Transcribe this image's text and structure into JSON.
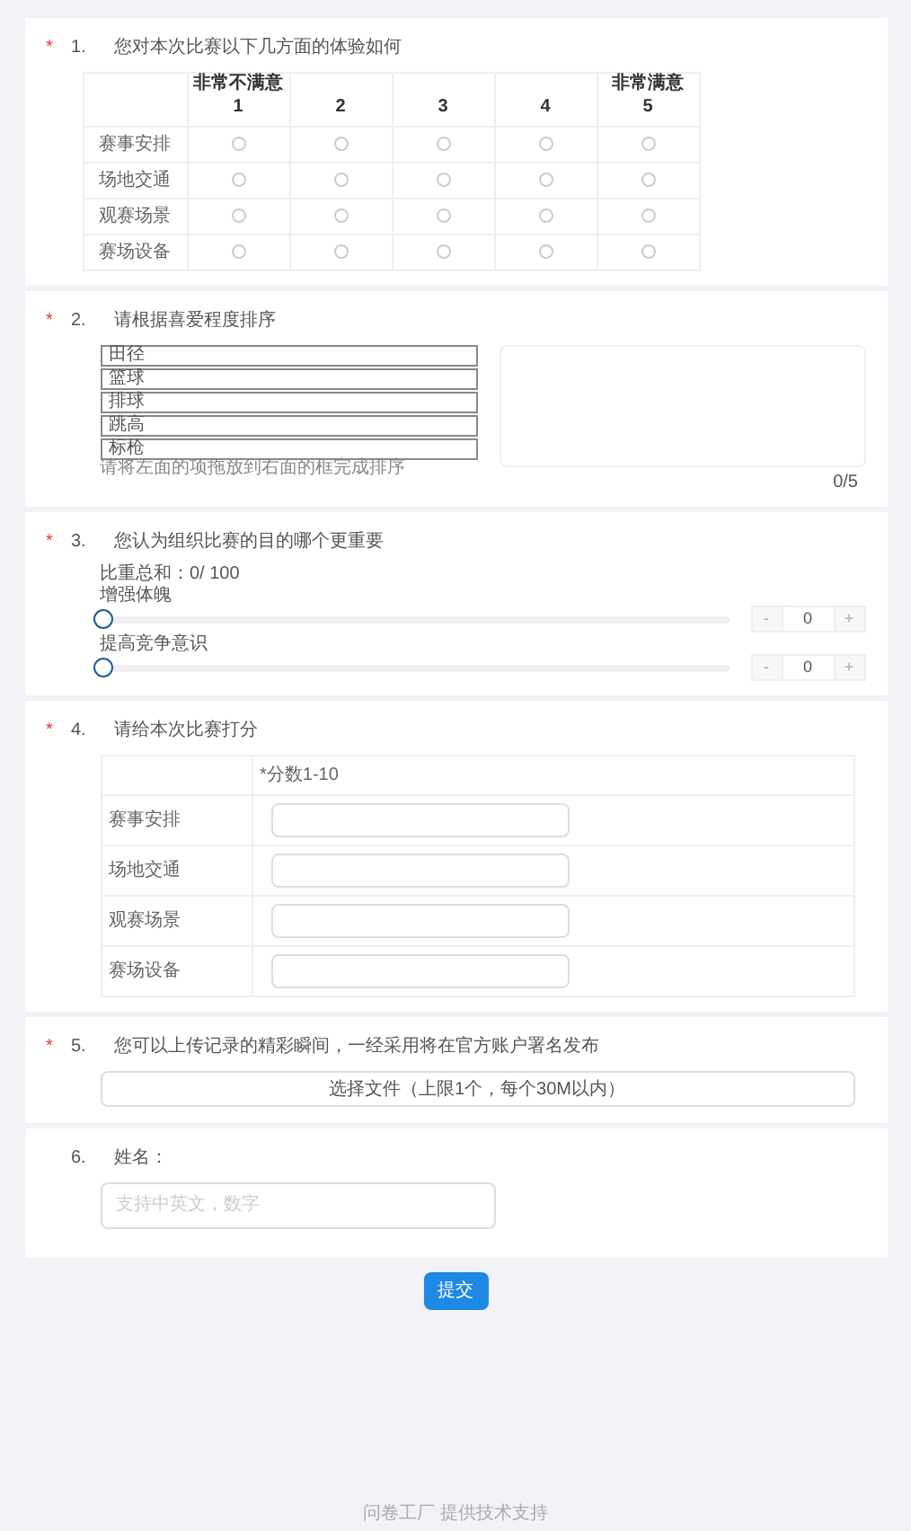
{
  "questions": [
    {
      "kind": "matrix",
      "mark": "*",
      "number": "1.",
      "title": "您对本次比赛以下几方面的体验如何",
      "columns": [
        {
          "label": "非常不满意",
          "value": "1"
        },
        {
          "value": "2"
        },
        {
          "value": "3"
        },
        {
          "value": "4"
        },
        {
          "label": "非常满意",
          "value": "5"
        }
      ],
      "rows": [
        {
          "label": "赛事安排",
          "choices": [
            {
              "selected": false
            },
            {
              "selected": false
            },
            {
              "selected": false
            },
            {
              "selected": false
            },
            {
              "selected": false
            }
          ]
        },
        {
          "label": "场地交通",
          "choices": [
            {
              "selected": false
            },
            {
              "selected": false
            },
            {
              "selected": false
            },
            {
              "selected": false
            },
            {
              "selected": false
            }
          ]
        },
        {
          "label": "观赛场景",
          "choices": [
            {
              "selected": false
            },
            {
              "selected": false
            },
            {
              "selected": false
            },
            {
              "selected": false
            },
            {
              "selected": false
            }
          ]
        },
        {
          "label": "赛场设备",
          "choices": [
            {
              "selected": false
            },
            {
              "selected": false
            },
            {
              "selected": false
            },
            {
              "selected": false
            },
            {
              "selected": false
            }
          ]
        }
      ]
    },
    {
      "kind": "sort",
      "mark": "*",
      "number": "2.",
      "title": "请根据喜爱程度排序",
      "items": [
        "田径",
        "篮球",
        "排球",
        "跳高",
        "标枪"
      ],
      "hint": "请将左面的项拖放到右面的框完成排序",
      "count": "0/5"
    },
    {
      "kind": "weights",
      "mark": "*",
      "number": "3.",
      "title": "您认为组织比赛的目的哪个更重要",
      "total": "比重总和：0/ 100",
      "options": [
        {
          "label": "增强体魄",
          "level": 0,
          "value": "0",
          "minus": "-",
          "plus": "+"
        },
        {
          "label": "提高竞争意识",
          "level": 0,
          "value": "0",
          "minus": "-",
          "plus": "+"
        }
      ]
    },
    {
      "kind": "scores",
      "mark": "*",
      "number": "4.",
      "title": "请给本次比赛打分",
      "header": "*分数1-10",
      "rows": [
        "赛事安排",
        "场地交通",
        "观赛场景",
        "赛场设备"
      ]
    },
    {
      "kind": "upload",
      "mark": "*",
      "number": "5.",
      "title": "您可以上传记录的精彩瞬间，一经采用将在官方账户署名发布",
      "button": "选择文件（上限1个，每个30M以内）"
    },
    {
      "kind": "text",
      "number": "6.",
      "title": "姓名：",
      "placeholder": "支持中英文，数字"
    }
  ],
  "submit": "提交",
  "footer": "问卷工厂 提供技术支持"
}
